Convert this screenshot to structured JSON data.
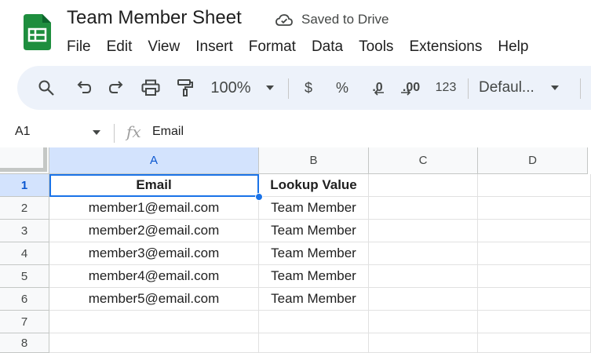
{
  "document": {
    "title": "Team Member Sheet",
    "save_status": "Saved to Drive"
  },
  "menu": [
    "File",
    "Edit",
    "View",
    "Insert",
    "Format",
    "Data",
    "Tools",
    "Extensions",
    "Help"
  ],
  "toolbar": {
    "zoom": "100%",
    "currency": "$",
    "percent": "%",
    "decrease_decimal": ".0",
    "increase_decimal": ".00",
    "number_format": "123",
    "font": "Defaul..."
  },
  "formula_bar": {
    "cell_ref": "A1",
    "fx": "fx",
    "value": "Email"
  },
  "grid": {
    "columns": [
      "A",
      "B",
      "C",
      "D"
    ],
    "rows": [
      "1",
      "2",
      "3",
      "4",
      "5",
      "6",
      "7",
      "8"
    ],
    "cells": [
      [
        "Email",
        "Lookup Value",
        "",
        ""
      ],
      [
        "member1@email.com",
        "Team Member",
        "",
        ""
      ],
      [
        "member2@email.com",
        "Team Member",
        "",
        ""
      ],
      [
        "member3@email.com",
        "Team Member",
        "",
        ""
      ],
      [
        "member4@email.com",
        "Team Member",
        "",
        ""
      ],
      [
        "member5@email.com",
        "Team Member",
        "",
        ""
      ],
      [
        "",
        "",
        "",
        ""
      ],
      [
        "",
        "",
        "",
        ""
      ]
    ]
  },
  "colors": {
    "brand_green": "#188038",
    "selection_blue": "#1a73e8",
    "header_selected": "#d3e3fd",
    "toolbar_bg": "#edf2fa"
  },
  "icons": [
    "sheets-logo-icon",
    "cloud-saved-icon",
    "search-icon",
    "undo-icon",
    "redo-icon",
    "print-icon",
    "paint-format-icon",
    "chevron-down-icon"
  ]
}
